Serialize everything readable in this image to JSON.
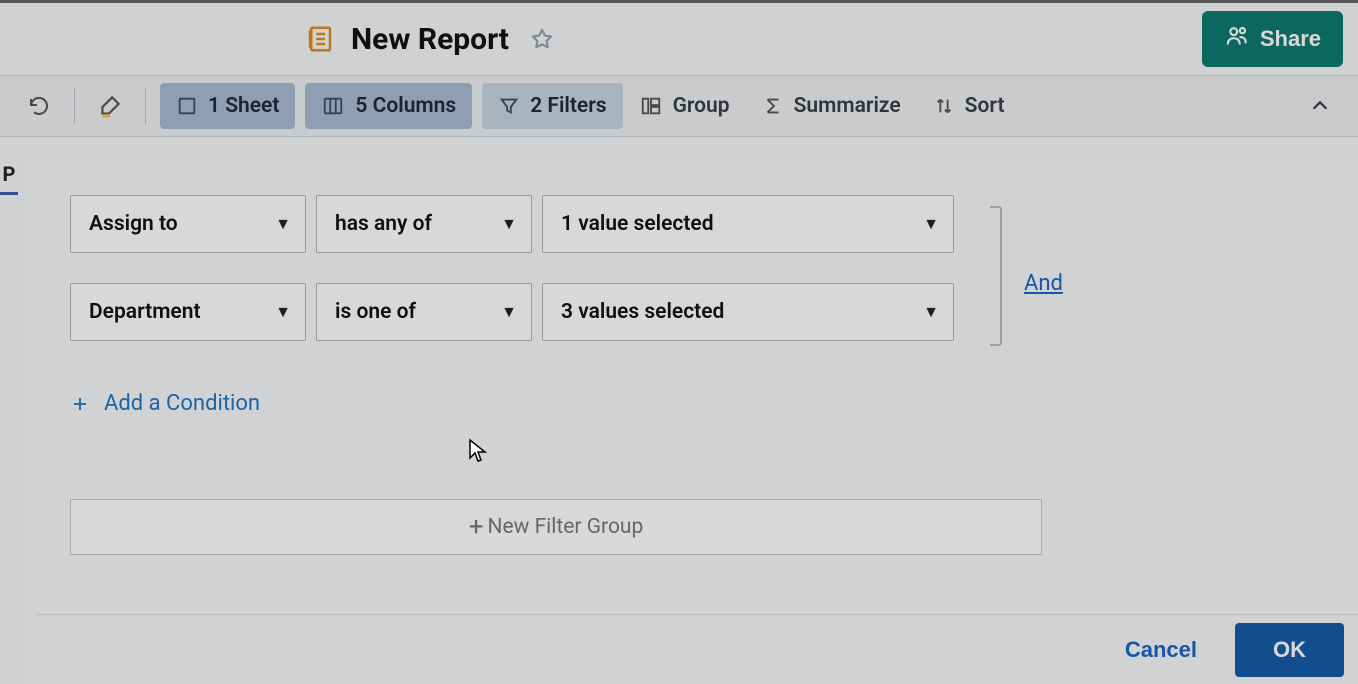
{
  "header": {
    "title": "New Report",
    "share_label": "Share"
  },
  "toolbar": {
    "sheet": {
      "label": "1 Sheet"
    },
    "columns": {
      "label": "5 Columns"
    },
    "filters": {
      "label": "2 Filters"
    },
    "group": {
      "label": "Group"
    },
    "summarize": {
      "label": "Summarize"
    },
    "sort": {
      "label": "Sort"
    }
  },
  "left_sliver": "P",
  "filters": {
    "conditions": [
      {
        "field": "Assign to",
        "operator": "has any of",
        "value_summary": "1 value selected"
      },
      {
        "field": "Department",
        "operator": "is one of",
        "value_summary": "3 values selected"
      }
    ],
    "logic_link": "And",
    "add_condition": "Add a Condition",
    "new_group": "New Filter Group"
  },
  "footer": {
    "cancel": "Cancel",
    "ok": "OK"
  }
}
